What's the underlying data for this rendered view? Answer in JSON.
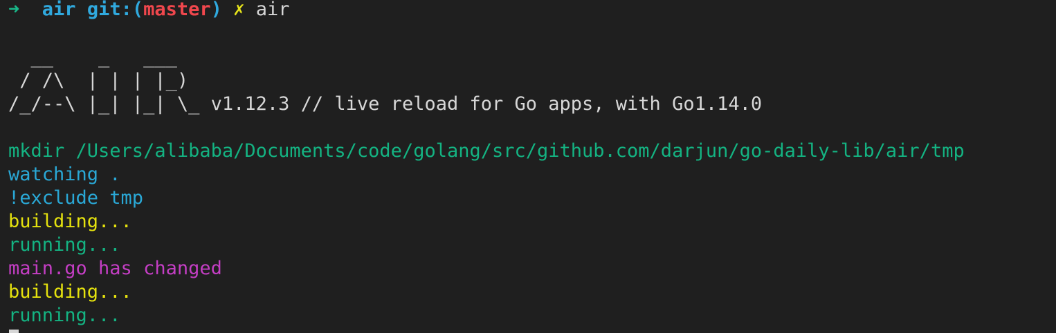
{
  "prompt": {
    "arrow": "➜",
    "dir": "air",
    "git_prefix": "git:(",
    "branch": "master",
    "git_suffix": ")",
    "dirty": "✗",
    "command": "air"
  },
  "banner": {
    "line1": "  __    _   ___  ",
    "line2": " / /\\  | | | |_) ",
    "line3": "/_/--\\ |_| |_| \\_ v1.12.3 // live reload for Go apps, with Go1.14.0"
  },
  "output": [
    {
      "text": "mkdir /Users/alibaba/Documents/code/golang/src/github.com/darjun/go-daily-lib/air/tmp",
      "color": "#14b382"
    },
    {
      "text": "watching .",
      "color": "#2aa8d6"
    },
    {
      "text": "!exclude tmp",
      "color": "#2aa8d6"
    },
    {
      "text": "building...",
      "color": "#e5e20e"
    },
    {
      "text": "running...",
      "color": "#14b382"
    },
    {
      "text": "main.go has changed",
      "color": "#c43ec4"
    },
    {
      "text": "building...",
      "color": "#e5e20e"
    },
    {
      "text": "running...",
      "color": "#14b382"
    }
  ]
}
